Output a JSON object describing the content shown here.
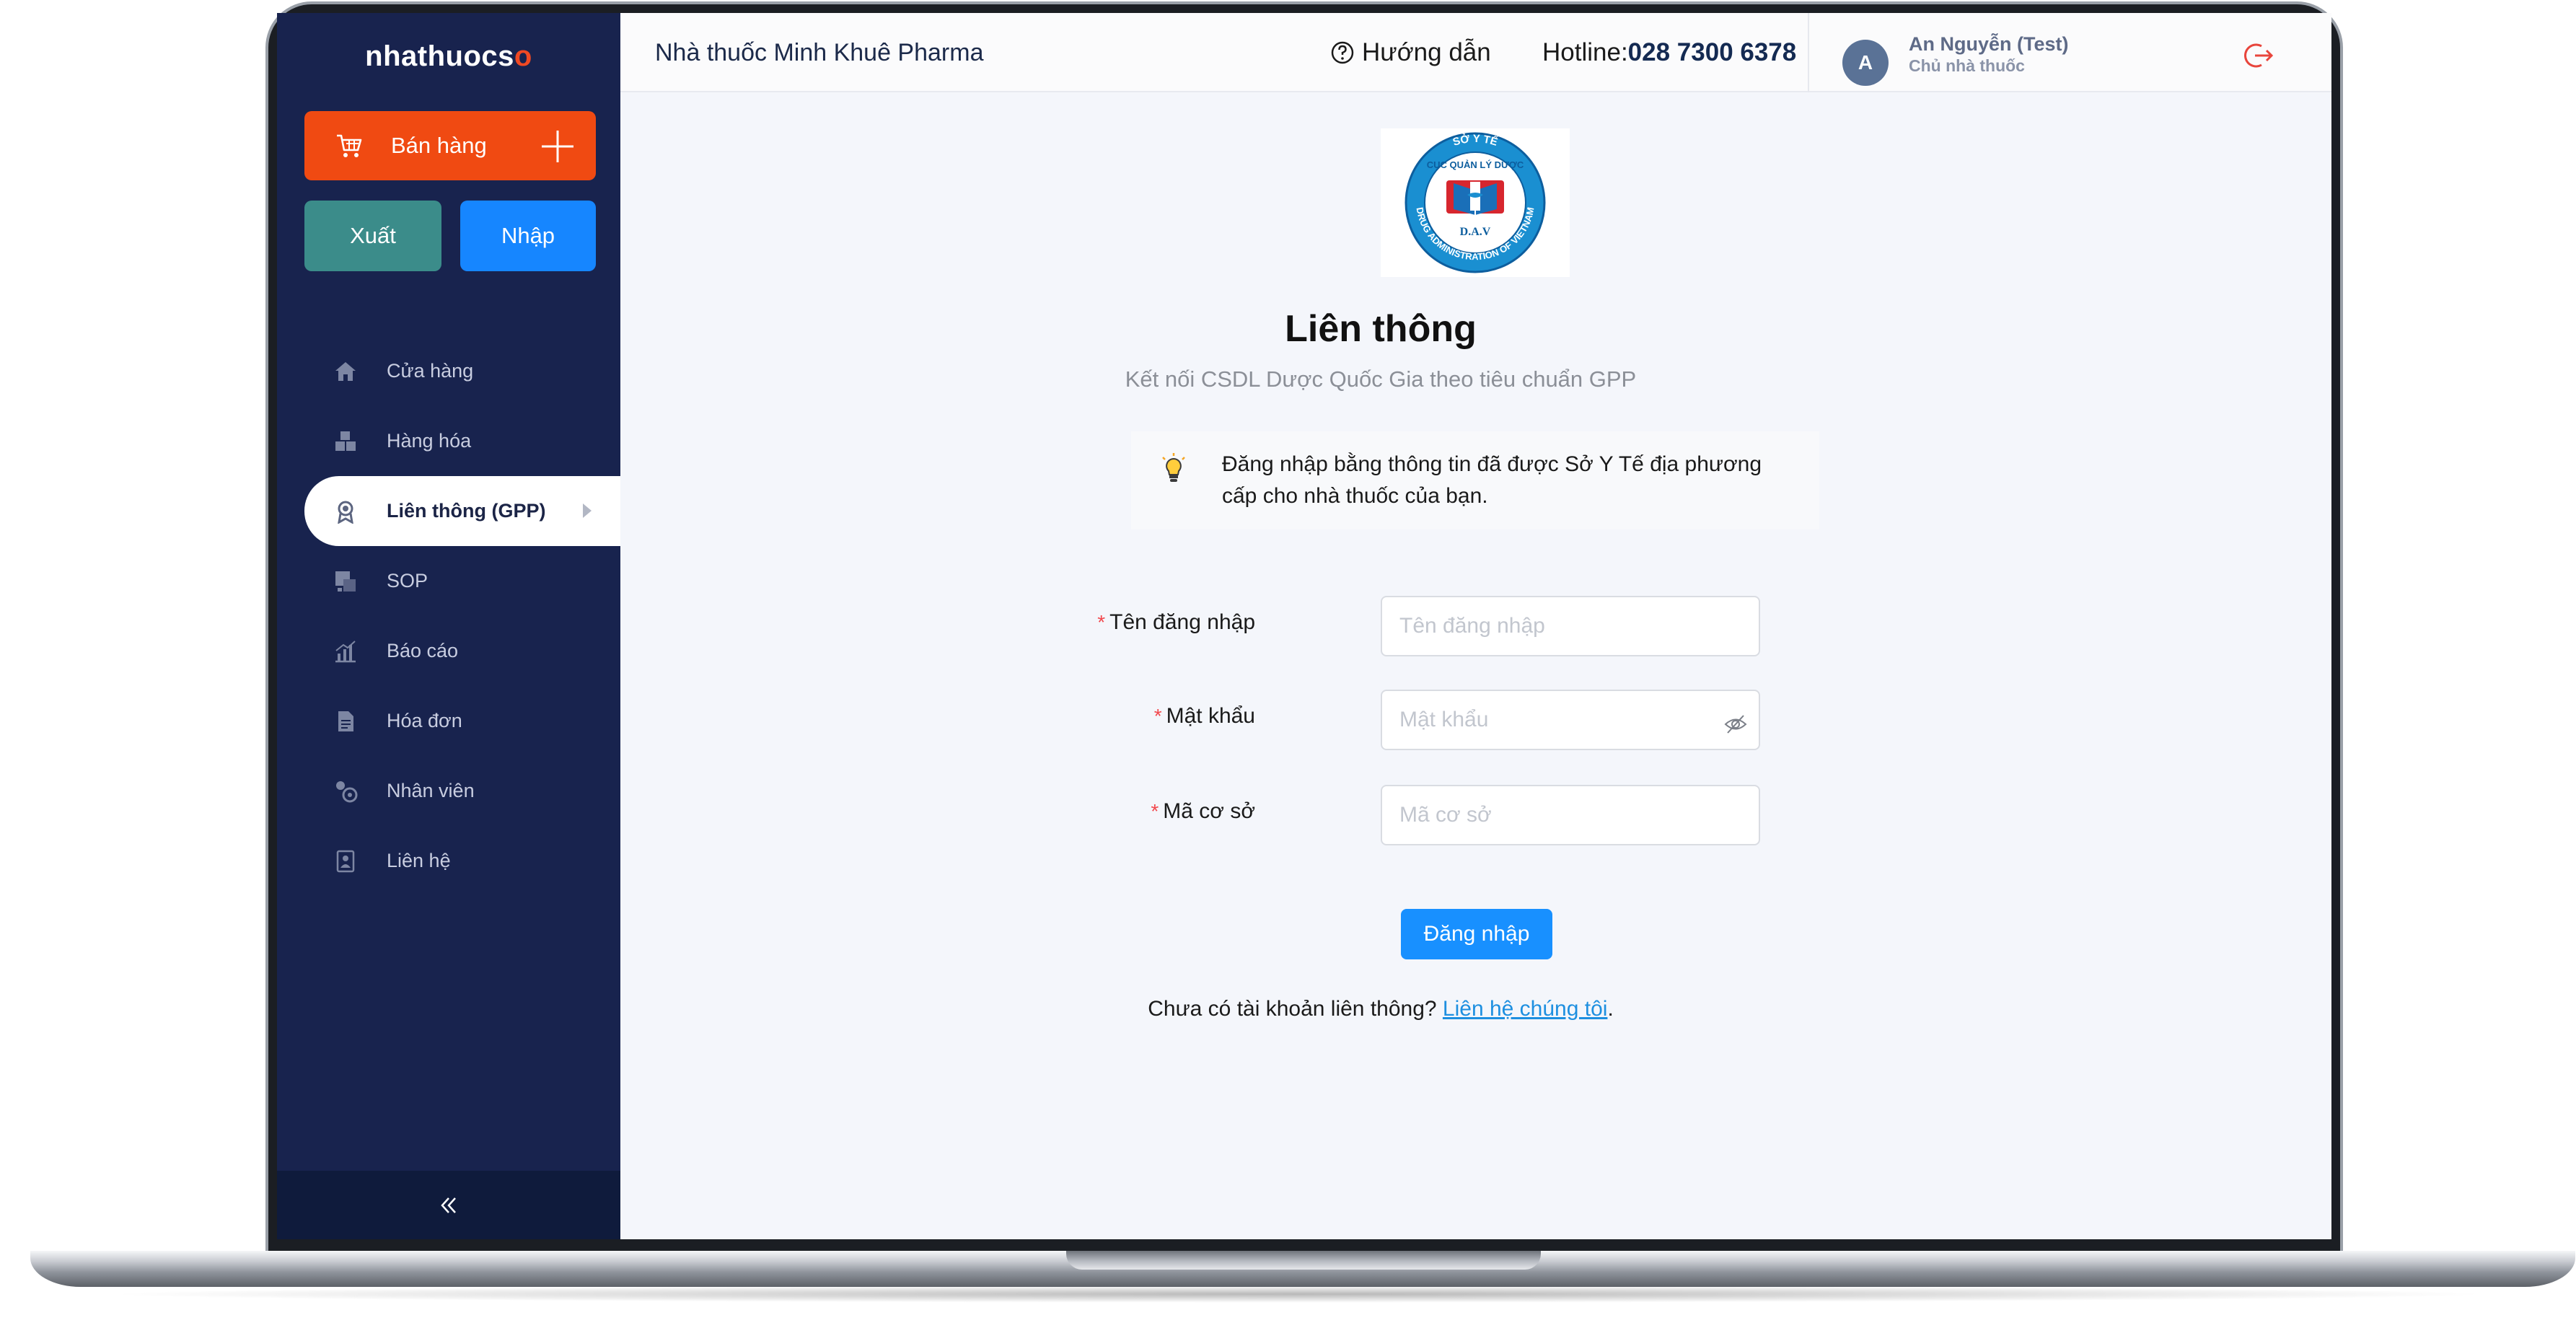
{
  "app": {
    "logo_text": "nhathuocs",
    "logo_suffix": "o"
  },
  "sidebar": {
    "sell_button": "Bán hàng",
    "export_button": "Xuất",
    "import_button": "Nhập",
    "items": [
      {
        "label": "Cửa hàng",
        "icon": "home-icon"
      },
      {
        "label": "Hàng hóa",
        "icon": "boxes-icon"
      },
      {
        "label": "Liên thông (GPP)",
        "icon": "award-icon",
        "active": true
      },
      {
        "label": "SOP",
        "icon": "sop-icon"
      },
      {
        "label": "Báo cáo",
        "icon": "chart-icon"
      },
      {
        "label": "Hóa đơn",
        "icon": "document-icon"
      },
      {
        "label": "Nhân viên",
        "icon": "users-icon"
      },
      {
        "label": "Liên hệ",
        "icon": "contact-icon"
      }
    ],
    "collapse_icon": "double-chevron-left-icon"
  },
  "header": {
    "store_name": "Nhà thuốc Minh Khuê Pharma",
    "guide": "Hướng dẫn",
    "hotline_label": "Hotline:",
    "hotline_number": "028 7300 6378",
    "avatar_initial": "A",
    "user_name": "An Nguyễn (Test)",
    "user_role": "Chủ nhà thuốc"
  },
  "main": {
    "title": "Liên thông",
    "subtitle": "Kết nối CSDL Dược Quốc Gia theo tiêu chuẩn GPP",
    "notice": "Đăng nhập bằng thông tin đã được Sở Y Tế địa phương cấp cho nhà thuốc của bạn.",
    "logo": {
      "top_text": "SỞ  Y  TẾ",
      "center_text": "CỤC QUẢN LÝ DƯỢC",
      "bottom_text": "D.A.V",
      "ring_text": "DRUG ADMINISTRATION OF VIETNAM"
    },
    "form": {
      "username_label": "Tên đăng nhập",
      "username_placeholder": "Tên đăng nhập",
      "password_label": "Mật khẩu",
      "password_placeholder": "Mật khẩu",
      "facility_label": "Mã cơ sở",
      "facility_placeholder": "Mã cơ sở",
      "required_mark": "*",
      "submit": "Đăng nhập"
    },
    "signup_text": "Chưa có tài khoản liên thông?",
    "signup_link": "Liên hệ chúng tôi",
    "signup_end": "."
  },
  "colors": {
    "sidebar_bg": "#18234e",
    "sell_orange": "#f04a12",
    "export_teal": "#3b8c8a",
    "import_blue": "#1686ff",
    "primary_blue": "#1890ff",
    "logout_red": "#e8453c"
  }
}
